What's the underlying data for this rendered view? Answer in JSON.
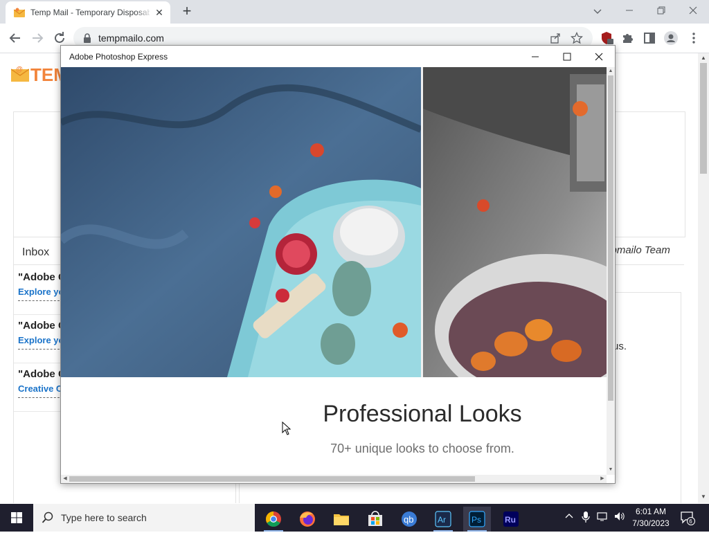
{
  "browser": {
    "tab_title": "Temp Mail - Temporary Disposable",
    "tab_close": "✕",
    "new_tab": "+",
    "url": "tempmailo.com"
  },
  "page": {
    "brand": "TEM",
    "inbox_label": "Inbox",
    "mails": [
      {
        "from": "\"Adobe C",
        "subject": "Explore yo"
      },
      {
        "from": "\"Adobe C",
        "subject": "Explore yo"
      },
      {
        "from": "\"Adobe C",
        "subject": "Creative C"
      }
    ],
    "team_text": "mpmailo Team",
    "body_fragment": "us."
  },
  "dialog": {
    "title": "Adobe Photoshop Express",
    "headline": "Professional Looks",
    "subline": "70+ unique looks to choose from."
  },
  "taskbar": {
    "search_placeholder": "Type here to search",
    "apps": [
      "chrome",
      "firefox",
      "file-explorer",
      "microsoft-store",
      "qbittorrent",
      "adobe-reader",
      "photoshop-express",
      "adobe-rush"
    ],
    "ps_label": "Ps",
    "ar_label": "Ar",
    "ru_label": "Ru",
    "time": "6:01 AM",
    "date": "7/30/2023",
    "notification_count": "6"
  },
  "colors": {
    "accent_orange": "#f2843b",
    "link_blue": "#1a73c9",
    "taskbar": "#1f1f2e"
  }
}
